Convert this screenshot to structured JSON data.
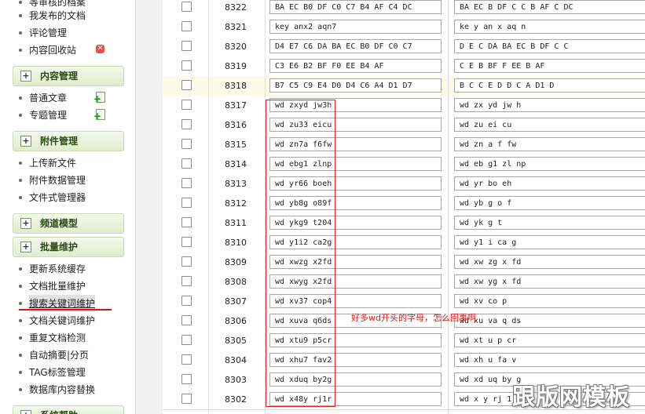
{
  "sidebar": {
    "items_top": [
      "等审核的档案",
      "我发布的文档",
      "评论管理",
      "内容回收站"
    ],
    "sections": [
      {
        "title": "内容管理",
        "items": [
          "普通文章",
          "专题管理"
        ]
      },
      {
        "title": "附件管理",
        "items": [
          "上传新文件",
          "附件数据管理",
          "文件式管理器"
        ]
      },
      {
        "title": "频道模型",
        "items": []
      },
      {
        "title": "批量维护",
        "items": [
          "更新系统缓存",
          "文档批量维护",
          "搜索关键词维护",
          "文档关键词维护",
          "重复文档检测",
          "自动摘要|分页",
          "TAG标签管理",
          "数据库内容替换"
        ]
      },
      {
        "title": "系统帮助",
        "items": []
      }
    ]
  },
  "rows": [
    {
      "id": "8322",
      "keyword": "BA EC B0 DF C0 C7 B4 AF C4 DC",
      "pinyin": "BA EC B DF C C B AF C DC"
    },
    {
      "id": "8321",
      "keyword": "key anx2 aqn7",
      "pinyin": "ke y an x aq n"
    },
    {
      "id": "8320",
      "keyword": "D4 E7 C6 DA BA EC B0 DF C0 C7",
      "pinyin": "D E C DA BA EC B DF C C"
    },
    {
      "id": "8319",
      "keyword": "C3 E6 B2 BF F0 EE B4 AF",
      "pinyin": "C E B BF F EE B AF"
    },
    {
      "id": "8318",
      "keyword": "B7 C5 C9 E4 D0 D4 C6 A4 D1 D7",
      "pinyin": "B C C E D D C A D1 D"
    },
    {
      "id": "8317",
      "keyword": "wd zxyd jw3h",
      "pinyin": "wd zx yd jw h"
    },
    {
      "id": "8316",
      "keyword": "wd zu33 eicu",
      "pinyin": "wd zu ei cu"
    },
    {
      "id": "8315",
      "keyword": "wd zn7a f6fw",
      "pinyin": "wd zn a f fw"
    },
    {
      "id": "8314",
      "keyword": "wd ebg1 zlnp",
      "pinyin": "wd eb g1 zl np"
    },
    {
      "id": "8313",
      "keyword": "wd yr66 boeh",
      "pinyin": "wd yr bo eh"
    },
    {
      "id": "8312",
      "keyword": "wd yb8g o89f",
      "pinyin": "wd yb g o f"
    },
    {
      "id": "8311",
      "keyword": "wd ykg9 t204",
      "pinyin": "wd yk g t"
    },
    {
      "id": "8310",
      "keyword": "wd y1i2 ca2g",
      "pinyin": "wd y1 i ca g"
    },
    {
      "id": "8309",
      "keyword": "wd xwzg x2fd",
      "pinyin": "wd xw zg x fd"
    },
    {
      "id": "8308",
      "keyword": "wd xwyg x2fd",
      "pinyin": "wd xw yg x fd"
    },
    {
      "id": "8307",
      "keyword": "wd xv37 cop4",
      "pinyin": "wd xv co p"
    },
    {
      "id": "8306",
      "keyword": "wd xuva q6ds",
      "pinyin": "wd xu va q ds"
    },
    {
      "id": "8305",
      "keyword": "wd xtu9 p5cr",
      "pinyin": "wd xt u p cr"
    },
    {
      "id": "8304",
      "keyword": "wd xhu7 fav2",
      "pinyin": "wd xh u fa v"
    },
    {
      "id": "8303",
      "keyword": "wd xduq by2g",
      "pinyin": "wd xd uq by g"
    },
    {
      "id": "8302",
      "keyword": "wd x48y rj1r",
      "pinyin": "wd x y rj 1r"
    }
  ],
  "annotation": "好多wd开头的字母，怎么回事啊",
  "watermark": "跟版网模板",
  "colors": {
    "annotation": "#e01818",
    "highlight_row": "#fbfbe8",
    "section_header": "#dfeccd"
  }
}
